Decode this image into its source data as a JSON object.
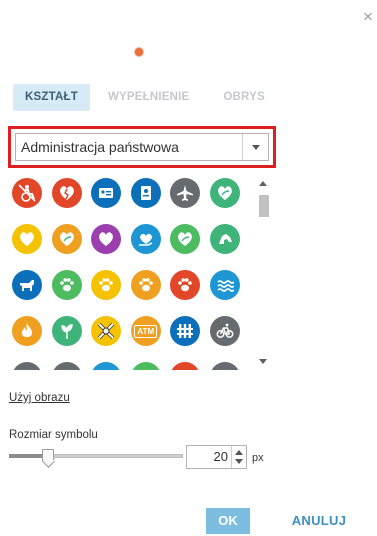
{
  "dialog": {
    "close_label": "×",
    "preview_color": "#e8703a"
  },
  "tabs": [
    {
      "label": "KSZTAŁT",
      "active": true
    },
    {
      "label": "WYPEŁNIENIE",
      "active": false
    },
    {
      "label": "OBRYS",
      "active": false
    }
  ],
  "category": {
    "value": "Administracja państwowa"
  },
  "symbols": [
    {
      "icon": "accessible-icon",
      "color": "#e2472a"
    },
    {
      "icon": "broken-heart-icon",
      "color": "#e2472a"
    },
    {
      "icon": "id-card-icon",
      "color": "#0b6fba"
    },
    {
      "icon": "id-badge-icon",
      "color": "#0b6fba"
    },
    {
      "icon": "airplane-icon",
      "color": "#666b70"
    },
    {
      "icon": "heart-leaf-icon",
      "color": "#3fb47a"
    },
    {
      "icon": "heart-icon",
      "color": "#f5c200"
    },
    {
      "icon": "heart-leaf-icon",
      "color": "#f0a020"
    },
    {
      "icon": "heart-icon",
      "color": "#9b3fae"
    },
    {
      "icon": "heart-hand-icon",
      "color": "#1e96d4"
    },
    {
      "icon": "heart-leaf-icon",
      "color": "#4dbb5f"
    },
    {
      "icon": "animal-icon",
      "color": "#3fb47a"
    },
    {
      "icon": "dog-icon",
      "color": "#0b6fba"
    },
    {
      "icon": "paw-icon",
      "color": "#4dbb5f"
    },
    {
      "icon": "paw-icon",
      "color": "#f5c200"
    },
    {
      "icon": "paw-icon",
      "color": "#f0a020"
    },
    {
      "icon": "paw-icon",
      "color": "#e2472a"
    },
    {
      "icon": "water-waves-icon",
      "color": "#1e96d4"
    },
    {
      "icon": "fire-icon",
      "color": "#f0a020"
    },
    {
      "icon": "plant-icon",
      "color": "#3fb47a"
    },
    {
      "icon": "railroad-crossing-icon",
      "color": "#f5c200"
    },
    {
      "icon": "atm-icon",
      "color": "#f0a020"
    },
    {
      "icon": "fence-icon",
      "color": "#0b6fba"
    },
    {
      "icon": "bicycle-icon",
      "color": "#666b70"
    },
    {
      "icon": "generic-symbol-icon",
      "color": "#666b70"
    },
    {
      "icon": "generic-symbol-icon",
      "color": "#666b70"
    },
    {
      "icon": "generic-symbol-icon",
      "color": "#1e96d4"
    },
    {
      "icon": "generic-symbol-icon",
      "color": "#4dbb5f"
    },
    {
      "icon": "generic-symbol-icon",
      "color": "#e2472a"
    },
    {
      "icon": "generic-symbol-icon",
      "color": "#666b70"
    }
  ],
  "atm_text": "ATM",
  "image_link": "Użyj obrazu",
  "size": {
    "label": "Rozmiar symbolu",
    "value": "20",
    "unit": "px",
    "slider_fraction": 0.19
  },
  "buttons": {
    "ok": "OK",
    "cancel": "ANULUJ"
  }
}
